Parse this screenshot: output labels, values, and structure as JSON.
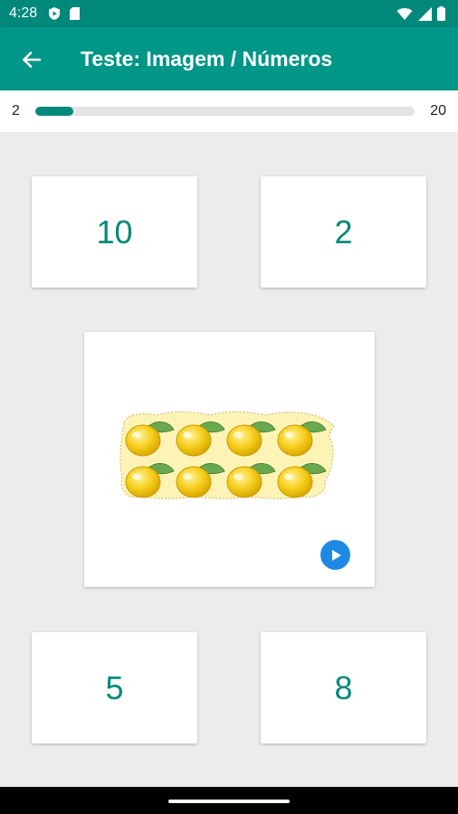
{
  "status": {
    "time": "4:28"
  },
  "appbar": {
    "title": "Teste: Imagem / Números",
    "back_icon": "arrow-back-icon"
  },
  "progress": {
    "current": "2",
    "total": "20",
    "fraction": 0.1
  },
  "answers": [
    {
      "label": "10"
    },
    {
      "label": "2"
    },
    {
      "label": "5"
    },
    {
      "label": "8"
    }
  ],
  "question": {
    "image": "lemons-8",
    "lemon_count": 8,
    "play_icon": "play-icon"
  },
  "colors": {
    "primary": "#009688",
    "accent": "#00897b",
    "play": "#1e88e5",
    "lemon": "#f5c518"
  }
}
